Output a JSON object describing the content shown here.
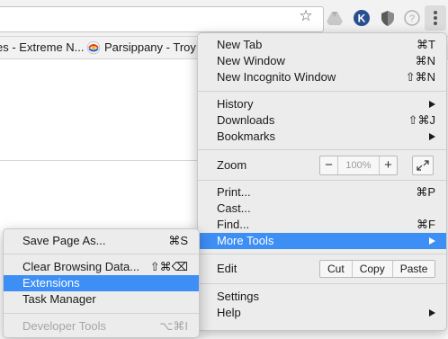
{
  "bookmarks": {
    "item1": "es - Extreme N...",
    "item2": "Parsippany - Troy"
  },
  "toolbar": {
    "star_icon": "star-icon",
    "extensions": [
      "drive-icon",
      "k-extension-icon",
      "shield-extension-icon",
      "help-icon"
    ],
    "menu_icon": "kebab-menu-icon"
  },
  "menu": {
    "new_tab": {
      "label": "New Tab",
      "shortcut": "⌘T"
    },
    "new_window": {
      "label": "New Window",
      "shortcut": "⌘N"
    },
    "new_incognito": {
      "label": "New Incognito Window",
      "shortcut": "⇧⌘N"
    },
    "history": {
      "label": "History"
    },
    "downloads": {
      "label": "Downloads",
      "shortcut": "⇧⌘J"
    },
    "bookmarks": {
      "label": "Bookmarks"
    },
    "zoom": {
      "label": "Zoom",
      "minus": "−",
      "value": "100%",
      "plus": "+"
    },
    "print": {
      "label": "Print...",
      "shortcut": "⌘P"
    },
    "cast": {
      "label": "Cast..."
    },
    "find": {
      "label": "Find...",
      "shortcut": "⌘F"
    },
    "more_tools": {
      "label": "More Tools"
    },
    "edit": {
      "label": "Edit",
      "cut": "Cut",
      "copy": "Copy",
      "paste": "Paste"
    },
    "settings": {
      "label": "Settings"
    },
    "help": {
      "label": "Help"
    }
  },
  "submenu": {
    "save_page": {
      "label": "Save Page As...",
      "shortcut": "⌘S"
    },
    "clear_data": {
      "label": "Clear Browsing Data...",
      "shortcut": "⇧⌘⌫"
    },
    "extensions": {
      "label": "Extensions"
    },
    "task_manager": {
      "label": "Task Manager"
    },
    "dev_tools": {
      "label": "Developer Tools",
      "shortcut": "⌥⌘I"
    }
  },
  "colors": {
    "highlight": "#3d8ef5",
    "menu_bg": "#ececec"
  }
}
